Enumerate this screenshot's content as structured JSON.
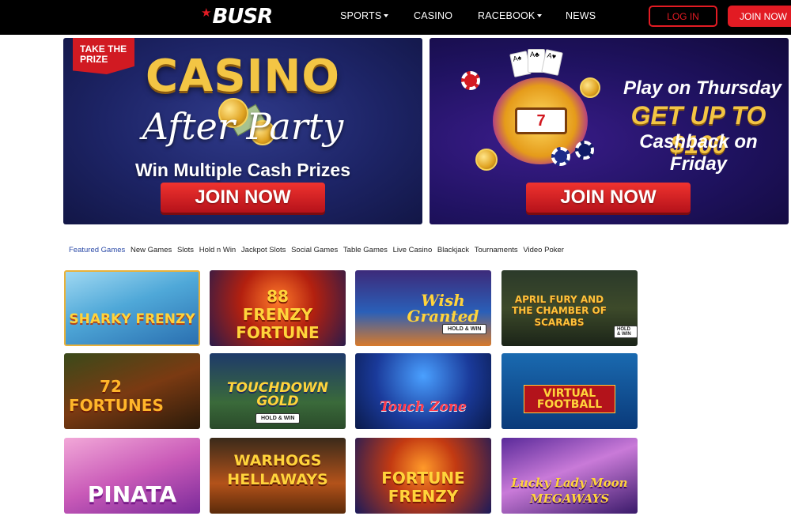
{
  "nav": {
    "logo_text": "BUSR",
    "items": [
      {
        "label": "SPORTS",
        "dropdown": true
      },
      {
        "label": "CASINO",
        "dropdown": false
      },
      {
        "label": "RACEBOOK",
        "dropdown": true
      },
      {
        "label": "NEWS",
        "dropdown": false
      }
    ],
    "login_label": "LOG IN",
    "join_label": "JOIN NOW",
    "accent_color": "#e21b23"
  },
  "banners": {
    "left": {
      "badge": "TAKE THE PRIZE",
      "title": "CASINO",
      "subtitle": "After Party",
      "tagline": "Win Multiple Cash Prizes",
      "cta": "JOIN NOW"
    },
    "right": {
      "line1": "Play on Thursday",
      "line2": "GET UP TO $100",
      "line3": "Cashback on Friday",
      "reel_text": "7",
      "cta": "JOIN NOW"
    }
  },
  "tabs": [
    {
      "label": "Featured Games",
      "active": true
    },
    {
      "label": "New Games",
      "active": false
    },
    {
      "label": "Slots",
      "active": false
    },
    {
      "label": "Hold n Win",
      "active": false
    },
    {
      "label": "Jackpot Slots",
      "active": false
    },
    {
      "label": "Social Games",
      "active": false
    },
    {
      "label": "Table Games",
      "active": false
    },
    {
      "label": "Live Casino",
      "active": false
    },
    {
      "label": "Blackjack",
      "active": false
    },
    {
      "label": "Tournaments",
      "active": false
    },
    {
      "label": "Video Poker",
      "active": false
    }
  ],
  "games": [
    {
      "title": "SHARKY FRENZY"
    },
    {
      "title": "88 FRENZY FORTUNE"
    },
    {
      "title": "Wish Granted",
      "badge": "HOLD & WIN"
    },
    {
      "title": "APRIL FURY AND THE CHAMBER OF SCARABS",
      "badge": "HOLD & WIN"
    },
    {
      "title": "72 FORTUNES"
    },
    {
      "title": "TOUCHDOWN GOLD",
      "badge": "HOLD & WIN"
    },
    {
      "title": "Touch Zone"
    },
    {
      "title": "VIRTUAL FOOTBALL"
    },
    {
      "title": "PINATA"
    },
    {
      "title": "WARHOGS HELLAWAYS"
    },
    {
      "title": "FORTUNE FRENZY"
    },
    {
      "title": "Lucky Lady Moon MEGAWAYS"
    }
  ]
}
